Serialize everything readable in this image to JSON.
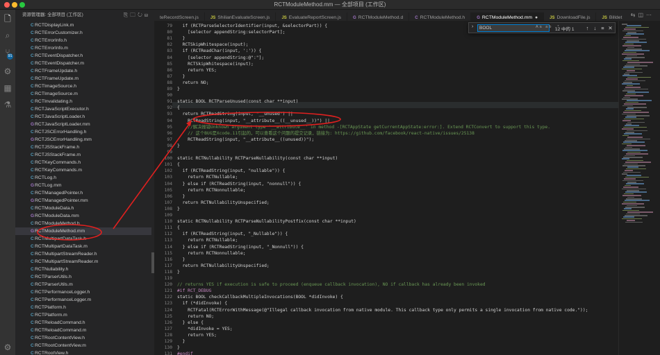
{
  "window": {
    "title": "RCTModuleMethod.mm — 全部项目 (工作区)"
  },
  "sidebar": {
    "header": "资源管理器: 全部项目 (工作区)",
    "items": [
      {
        "t": "C",
        "label": "RCTDisplayLink.m"
      },
      {
        "t": "C",
        "label": "RCTErrorCustomizer.h"
      },
      {
        "t": "C",
        "label": "RCTErrorInfo.h"
      },
      {
        "t": "C",
        "label": "RCTErrorInfo.m"
      },
      {
        "t": "C",
        "label": "RCTEventDispatcher.h"
      },
      {
        "t": "C",
        "label": "RCTEventDispatcher.m"
      },
      {
        "t": "C",
        "label": "RCTFrameUpdate.h"
      },
      {
        "t": "C",
        "label": "RCTFrameUpdate.m"
      },
      {
        "t": "C",
        "label": "RCTImageSource.h"
      },
      {
        "t": "C",
        "label": "RCTImageSource.m"
      },
      {
        "t": "C",
        "label": "RCTInvalidating.h"
      },
      {
        "t": "C",
        "label": "RCTJavaScriptExecutor.h"
      },
      {
        "t": "C",
        "label": "RCTJavaScriptLoader.h"
      },
      {
        "t": "G",
        "label": "RCTJavaScriptLoader.mm"
      },
      {
        "t": "C",
        "label": "RCTJSCErrorHandling.h"
      },
      {
        "t": "G",
        "label": "RCTJSCErrorHandling.mm"
      },
      {
        "t": "C",
        "label": "RCTJSStackFrame.h"
      },
      {
        "t": "C",
        "label": "RCTJSStackFrame.m"
      },
      {
        "t": "C",
        "label": "RCTKeyCommands.h"
      },
      {
        "t": "C",
        "label": "RCTKeyCommands.m"
      },
      {
        "t": "C",
        "label": "RCTLog.h"
      },
      {
        "t": "G",
        "label": "RCTLog.mm"
      },
      {
        "t": "C",
        "label": "RCTManagedPointer.h"
      },
      {
        "t": "G",
        "label": "RCTManagedPointer.mm"
      },
      {
        "t": "C",
        "label": "RCTModuleData.h"
      },
      {
        "t": "G",
        "label": "RCTModuleData.mm"
      },
      {
        "t": "C",
        "label": "RCTModuleMethod.h"
      },
      {
        "t": "G",
        "label": "RCTModuleMethod.mm"
      },
      {
        "t": "C",
        "label": "RCTMultipartDataTask.h"
      },
      {
        "t": "C",
        "label": "RCTMultipartDataTask.m"
      },
      {
        "t": "C",
        "label": "RCTMultipartStreamReader.h"
      },
      {
        "t": "C",
        "label": "RCTMultipartStreamReader.m"
      },
      {
        "t": "C",
        "label": "RCTNullability.h"
      },
      {
        "t": "C",
        "label": "RCTParserUtils.h"
      },
      {
        "t": "C",
        "label": "RCTParserUtils.m"
      },
      {
        "t": "C",
        "label": "RCTPerformanceLogger.h"
      },
      {
        "t": "C",
        "label": "RCTPerformanceLogger.m"
      },
      {
        "t": "C",
        "label": "RCTPlatform.h"
      },
      {
        "t": "C",
        "label": "RCTPlatform.m"
      },
      {
        "t": "C",
        "label": "RCTReloadCommand.h"
      },
      {
        "t": "C",
        "label": "RCTReloadCommand.m"
      },
      {
        "t": "C",
        "label": "RCTRootContentView.h"
      },
      {
        "t": "C",
        "label": "RCTRootContentView.m"
      },
      {
        "t": "C",
        "label": "RCTRootView.h"
      }
    ],
    "selected_index": 27
  },
  "activity": {
    "badge": "91"
  },
  "tabs": [
    {
      "icon": "",
      "label": "teRecordScreen.js",
      "active": false
    },
    {
      "icon": "JS",
      "label": "ShilianEvaluateScreen.js",
      "active": false
    },
    {
      "icon": "JS",
      "label": "EvaluateReportScreen.js",
      "active": false
    },
    {
      "icon": "G",
      "label": "RCTModuleMethod.d",
      "active": false
    },
    {
      "icon": "C",
      "label": "RCTModuleMethod.h",
      "active": false
    },
    {
      "icon": "G",
      "label": "RCTModuleMethod.mm",
      "active": true,
      "dirty": "●"
    },
    {
      "icon": "JS",
      "label": "DownloadFile.js",
      "active": false
    },
    {
      "icon": "JS",
      "label": "Billdet",
      "active": false
    }
  ],
  "find": {
    "query": "BOOL",
    "count": "12 中的 1",
    "options": "Aa ab .*"
  },
  "code": [
    {
      "n": "79",
      "t": "  if (RCTParseSelectorIdentifier(input, &selectorPart)) {",
      "c": ""
    },
    {
      "n": "80",
      "t": "    [selector appendString:selectorPart];",
      "c": ""
    },
    {
      "n": "81",
      "t": "  }",
      "c": ""
    },
    {
      "n": "82",
      "t": "  RCTSkipWhitespace(input);",
      "c": ""
    },
    {
      "n": "83",
      "t": "  if (RCTReadChar(input, ':')) {",
      "c": ""
    },
    {
      "n": "84",
      "t": "    [selector appendString:@\":\"];",
      "c": ""
    },
    {
      "n": "85",
      "t": "    RCTSkipWhitespace(input);",
      "c": ""
    },
    {
      "n": "86",
      "t": "    return YES;",
      "c": ""
    },
    {
      "n": "87",
      "t": "  }",
      "c": ""
    },
    {
      "n": "88",
      "t": "  return NO;",
      "c": ""
    },
    {
      "n": "89",
      "t": "}",
      "c": ""
    },
    {
      "n": "90",
      "t": "",
      "c": ""
    },
    {
      "n": "91",
      "t": "static BOOL RCTParseUnused(const char **input)",
      "c": ""
    },
    {
      "n": "92",
      "t": "{",
      "c": ""
    },
    {
      "n": "93",
      "t": "  return RCTReadString(input, \"__unused\") ||",
      "c": ""
    },
    {
      "n": "94",
      "t": "    RCTReadString(input, \"__attribute__((__unused__))\") ||",
      "c": ""
    },
    {
      "n": "95",
      "t": "    //解决报错Unknown argument type '__attribute__' in method -[RCTAppState getCurrentAppState:error:]. Extend RCTConvert to support this type.",
      "c": "cm"
    },
    {
      "n": "96",
      "t": "    // 这个BUG是Xcode.11引起的，可以查看这个问题的提交记录，链接为: https://github.com/facebook/react-native/issues/25138",
      "c": "cm"
    },
    {
      "n": "97",
      "t": "    RCTReadString(input, \"__attribute__((unused))\");",
      "c": ""
    },
    {
      "n": "98",
      "t": "}",
      "c": ""
    },
    {
      "n": "99",
      "t": "",
      "c": ""
    },
    {
      "n": "100",
      "t": "static RCTNullability RCTParseNullability(const char **input)",
      "c": ""
    },
    {
      "n": "101",
      "t": "{",
      "c": ""
    },
    {
      "n": "102",
      "t": "  if (RCTReadString(input, \"nullable\")) {",
      "c": ""
    },
    {
      "n": "103",
      "t": "    return RCTNullable;",
      "c": ""
    },
    {
      "n": "104",
      "t": "  } else if (RCTReadString(input, \"nonnull\")) {",
      "c": ""
    },
    {
      "n": "105",
      "t": "    return RCTNonnullable;",
      "c": ""
    },
    {
      "n": "106",
      "t": "  }",
      "c": ""
    },
    {
      "n": "107",
      "t": "  return RCTNullabilityUnspecified;",
      "c": ""
    },
    {
      "n": "108",
      "t": "}",
      "c": ""
    },
    {
      "n": "109",
      "t": "",
      "c": ""
    },
    {
      "n": "110",
      "t": "static RCTNullability RCTParseNullabilityPostfix(const char **input)",
      "c": ""
    },
    {
      "n": "111",
      "t": "{",
      "c": ""
    },
    {
      "n": "112",
      "t": "  if (RCTReadString(input, \"_Nullable\")) {",
      "c": ""
    },
    {
      "n": "113",
      "t": "    return RCTNullable;",
      "c": ""
    },
    {
      "n": "114",
      "t": "  } else if (RCTReadString(input, \"_Nonnull\")) {",
      "c": ""
    },
    {
      "n": "115",
      "t": "    return RCTNonnullable;",
      "c": ""
    },
    {
      "n": "116",
      "t": "  }",
      "c": ""
    },
    {
      "n": "117",
      "t": "  return RCTNullabilityUnspecified;",
      "c": ""
    },
    {
      "n": "118",
      "t": "}",
      "c": ""
    },
    {
      "n": "119",
      "t": "",
      "c": ""
    },
    {
      "n": "120",
      "t": "// returns YES if execution is safe to proceed (enqueue callback invocation), NO if callback has already been invoked",
      "c": "cm"
    },
    {
      "n": "121",
      "t": "#if RCT_DEBUG",
      "c": "pp"
    },
    {
      "n": "122",
      "t": "static BOOL checkCallbackMultipleInvocations(BOOL *didInvoke) {",
      "c": ""
    },
    {
      "n": "123",
      "t": "  if (*didInvoke) {",
      "c": ""
    },
    {
      "n": "124",
      "t": "    RCTFatal(RCTErrorWithMessage(@\"Illegal callback invocation from native module. This callback type only permits a single invocation from native code.\"));",
      "c": ""
    },
    {
      "n": "125",
      "t": "    return NO;",
      "c": ""
    },
    {
      "n": "126",
      "t": "  } else {",
      "c": ""
    },
    {
      "n": "127",
      "t": "    *didInvoke = YES;",
      "c": ""
    },
    {
      "n": "128",
      "t": "    return YES;",
      "c": ""
    },
    {
      "n": "129",
      "t": "  }",
      "c": ""
    },
    {
      "n": "130",
      "t": "}",
      "c": ""
    },
    {
      "n": "131",
      "t": "#endif",
      "c": "pp"
    }
  ]
}
